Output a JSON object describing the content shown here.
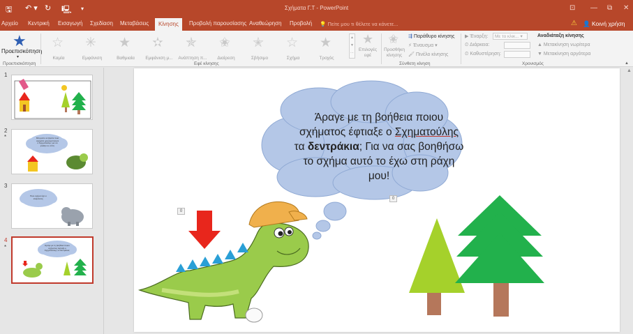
{
  "titlebar": {
    "title": "Σχήματα Γ.Τ - PowerPoint",
    "save_glyph": "🖫",
    "undo_glyph": "↶ ▾",
    "redo_glyph": "↻",
    "present_glyph": "🖳",
    "more_glyph": "▾",
    "ribbon_display_glyph": "⊡",
    "minimize_glyph": "—",
    "restore_glyph": "⧉",
    "close_glyph": "✕",
    "bg_color": "#b7472a"
  },
  "tabs": [
    {
      "label": "Αρχείο"
    },
    {
      "label": "Κεντρική"
    },
    {
      "label": "Εισαγωγή"
    },
    {
      "label": "Σχεδίαση"
    },
    {
      "label": "Μεταβάσεις"
    },
    {
      "label": "Κίνησης",
      "active": true
    },
    {
      "label": "Προβολή παρουσίασης"
    },
    {
      "label": "Αναθεώρηση"
    },
    {
      "label": "Προβολή"
    }
  ],
  "tell_me": "Πείτε μου τι θέλετε να κάνετε...",
  "warning_glyph": "⚠",
  "share_label": "Κοινή χρήση",
  "ribbon": {
    "preview_label": "Προεπισκόπηση",
    "preview_group": "Προεπισκόπηση",
    "effects": [
      {
        "label": "Καμία",
        "glyph": "☆"
      },
      {
        "label": "Εμφάνιση",
        "glyph": "✳"
      },
      {
        "label": "Βαθμιαία",
        "glyph": "★"
      },
      {
        "label": "Εμφάνιση μ...",
        "glyph": "✫"
      },
      {
        "label": "Ανάπτηση π...",
        "glyph": "✯"
      },
      {
        "label": "Διαίρεση",
        "glyph": "✬"
      },
      {
        "label": "Σβήσιμο",
        "glyph": "✭"
      },
      {
        "label": "Σχήμα",
        "glyph": "☆"
      },
      {
        "label": "Τροχός",
        "glyph": "★"
      }
    ],
    "effects_group": "Εφέ κίνησης",
    "effect_options": "Επιλογές εφέ",
    "add_animation": "Προσθήκη κίνησης",
    "animation_pane": "Παράθυρο κίνησης",
    "trigger": "Έναυσμα",
    "animation_painter": "Πινέλο κίνησης",
    "advanced_group": "Σύνθετη κίνηση",
    "start_label": "Έναρξη:",
    "start_value": "Με το κλικ...",
    "duration_label": "Διάρκεια:",
    "delay_label": "Καθυστέρηση:",
    "reorder_label": "Αναδιάταξη κίνησης",
    "move_earlier": "Μετακίνηση νωρίτερα",
    "move_later": "Μετακίνηση αργότερα",
    "timing_group": "Χρονισμός"
  },
  "slides": [
    {
      "number": "1"
    },
    {
      "number": "2",
      "marker": "*",
      "bubble_text": "Μπορείτε να βρείτε ποια σχήματα χρησιμοποίησε ο Σχηματούλης για να φτιάξει το σπίτι;"
    },
    {
      "number": "3",
      "bubble_text": "Ποιο σχήμα έχει ο ελέφαντας;"
    },
    {
      "number": "4",
      "marker": "*",
      "active": true,
      "bubble_text": "Άραγε με τη βοήθεια ποιου σχήματος έφτιαξε ο Σχηματούλης τα δεντράκια;"
    }
  ],
  "slide": {
    "bubble_line1": "Άραγε με τη βοήθεια ποιου",
    "bubble_line2_pre": "σχήματος έφτιαξε ο ",
    "bubble_line2_name": "Σχηματούλης",
    "bubble_line3_pre": "τα ",
    "bubble_line3_bold": "δεντράκια",
    "bubble_line3_post": "; Για να σας βοηθήσω",
    "bubble_line4": "το σχήμα αυτό το έχω στη ράχη",
    "bubble_line5": "μου!",
    "anim_tag_1": "0",
    "anim_tag_2": "0"
  },
  "colors": {
    "accent": "#b7472a",
    "cloud_fill": "#b4c7e7",
    "arrow_red": "#e8261c",
    "tree_green": "#22b14c",
    "tree_light": "#a5d12b",
    "trunk": "#b5775b",
    "dino_green": "#9acb4b",
    "cap_orange": "#f0b04c",
    "spikes_blue": "#2a9fd6"
  }
}
